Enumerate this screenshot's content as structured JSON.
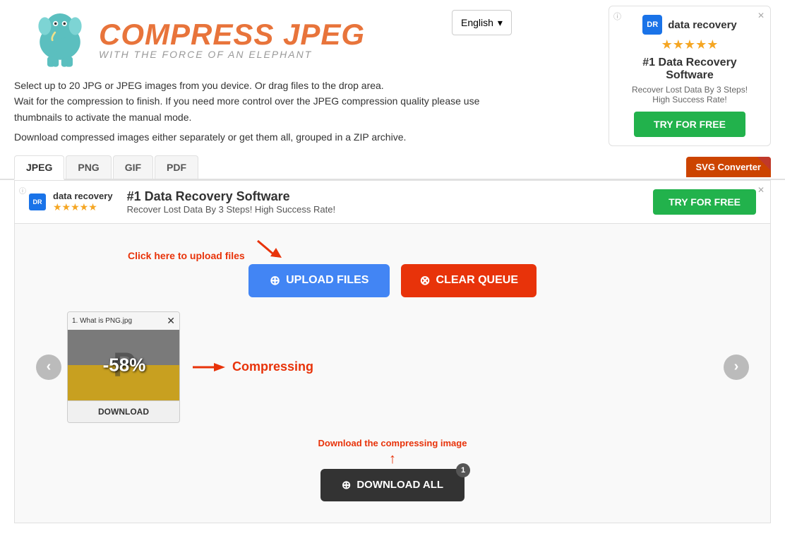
{
  "header": {
    "logo_title": "COMPRESS JPEG",
    "logo_subtitle": "WITH THE FORCE OF AN ELEPHANT",
    "lang_label": "English"
  },
  "description": {
    "line1": "Select up to 20 JPG or JPEG images from you device. Or drag files to the drop area.",
    "line2": "Wait for the compression to finish. If you need more control over the JPEG compression quality please use thumbnails to activate the manual mode.",
    "line3": "Download compressed images either separately or get them all, grouped in a ZIP archive."
  },
  "tabs": {
    "items": [
      "JPEG",
      "PNG",
      "GIF",
      "PDF"
    ],
    "active": "JPEG",
    "svg_converter": "SVG Converter"
  },
  "ad_right": {
    "brand": "data recovery",
    "stars": "★★★★★",
    "title": "#1 Data Recovery Software",
    "subtitle1": "Recover Lost Data By 3 Steps!",
    "subtitle2": "High Success Rate!",
    "try_btn": "TRY FOR FREE"
  },
  "inner_ad": {
    "brand": "data recovery",
    "stars": "★★★★★",
    "title": "#1 Data Recovery Software",
    "subtitle": "Recover Lost Data By 3 Steps!  High Success Rate!",
    "try_btn": "TRY FOR FREE"
  },
  "upload_area": {
    "click_hint": "Click here to upload files",
    "upload_btn": "UPLOAD FILES",
    "clear_btn": "CLEAR QUEUE"
  },
  "file_card": {
    "name": "1. What is PNG.jpg",
    "percent": "-58%",
    "download_btn": "DOWNLOAD",
    "compressing_label": "Compressing"
  },
  "download_all": {
    "hint": "Download the compressing image",
    "btn": "DOWNLOAD ALL",
    "count": "1"
  },
  "nav": {
    "prev": "‹",
    "next": "›"
  }
}
